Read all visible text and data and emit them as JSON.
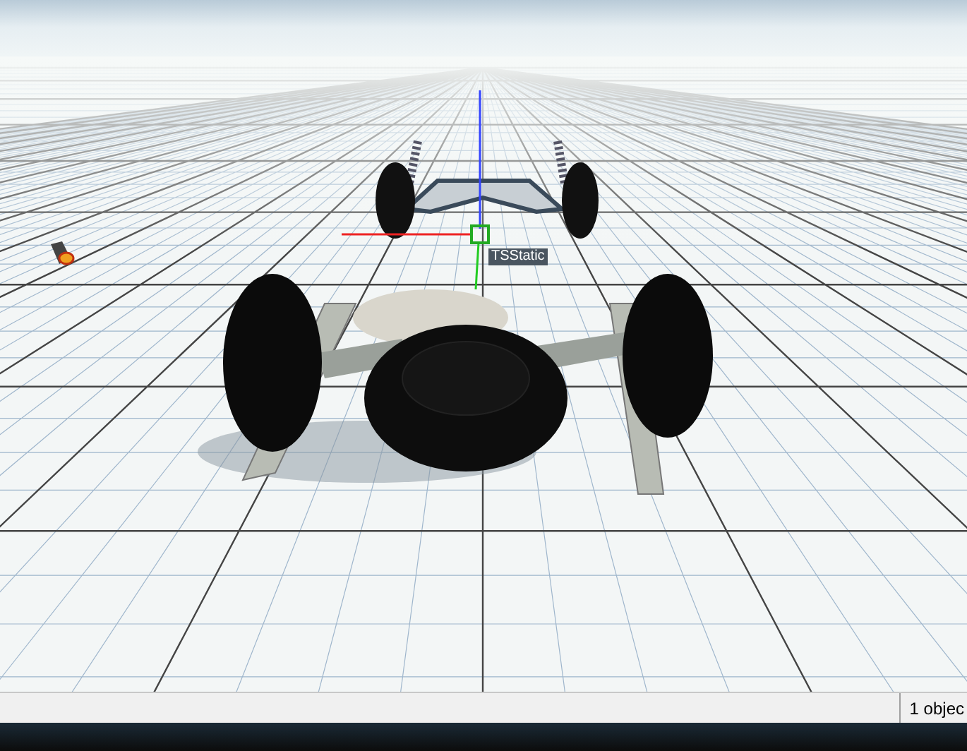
{
  "viewport": {
    "object_label": "TSStatic"
  },
  "status_bar": {
    "selection": "1 objec"
  }
}
